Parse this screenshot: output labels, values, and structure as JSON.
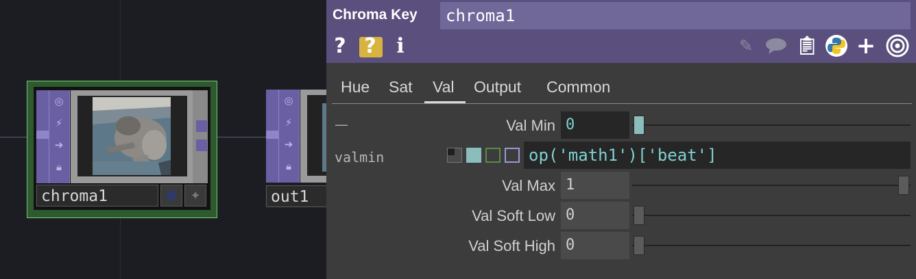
{
  "network": {
    "nodes": [
      {
        "name": "chroma1"
      },
      {
        "name": "out1"
      }
    ]
  },
  "panel": {
    "op_type": "Chroma Key",
    "op_name": "chroma1",
    "header_icons": {
      "help": "?",
      "python_help": "?",
      "info": "i"
    },
    "tabs": [
      "Hue",
      "Sat",
      "Val",
      "Output",
      "Common"
    ],
    "active_tab": "Val",
    "dash": "—",
    "params": {
      "val_min": {
        "label": "Val Min",
        "value": "0"
      },
      "expr_name": "valmin",
      "expression": "op('math1')['beat']",
      "val_max": {
        "label": "Val Max",
        "value": "1"
      },
      "val_soft_low": {
        "label": "Val Soft Low",
        "value": "0"
      },
      "val_soft_high": {
        "label": "Val Soft High",
        "value": "0"
      }
    },
    "slider_levels": {
      "val_min": 0,
      "val_max": 1,
      "val_soft_low": 0,
      "val_soft_high": 0
    },
    "colors": {
      "header": "#5a4f7d",
      "name_field": "#71689a",
      "expression_text": "#7fd0d0",
      "node_selected_frame": "#6fd06f",
      "operator_strip": "#6b5fa3"
    }
  }
}
